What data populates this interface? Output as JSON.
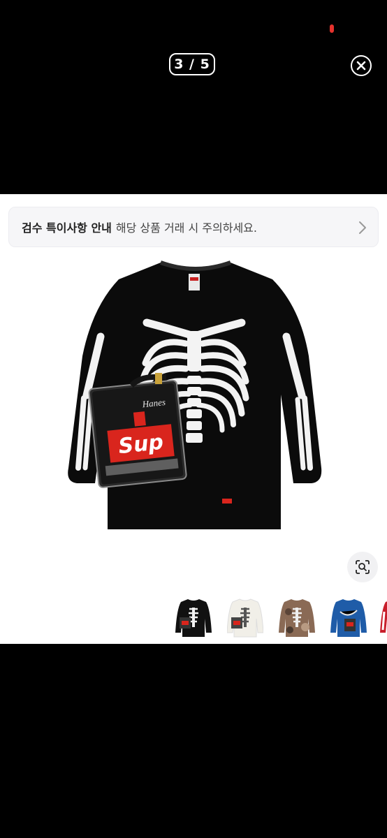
{
  "viewer": {
    "counter": "3 / 5"
  },
  "notice": {
    "title": "검수 특이사항 안내",
    "description": "해당 상품 거래 시 주의하세요."
  },
  "product": {
    "shirt_color": "#0b0b0b",
    "bones_color": "#f3f3f3",
    "box_logo_text": "Sup",
    "box_logo_color": "#d9251d",
    "package_brand": "Hanes"
  },
  "thumbnails": [
    {
      "name": "black",
      "color": "#111111",
      "bones": "#f2f2f2"
    },
    {
      "name": "white",
      "color": "#f1efe8",
      "bones": "#555555"
    },
    {
      "name": "camo",
      "color": "#8a6a55",
      "bones": "#eeeeee"
    },
    {
      "name": "blue",
      "color": "#1f5ca8",
      "bones": "#e8e8e8"
    },
    {
      "name": "red",
      "color": "#c81e2b",
      "bones": "#ffffff"
    }
  ]
}
